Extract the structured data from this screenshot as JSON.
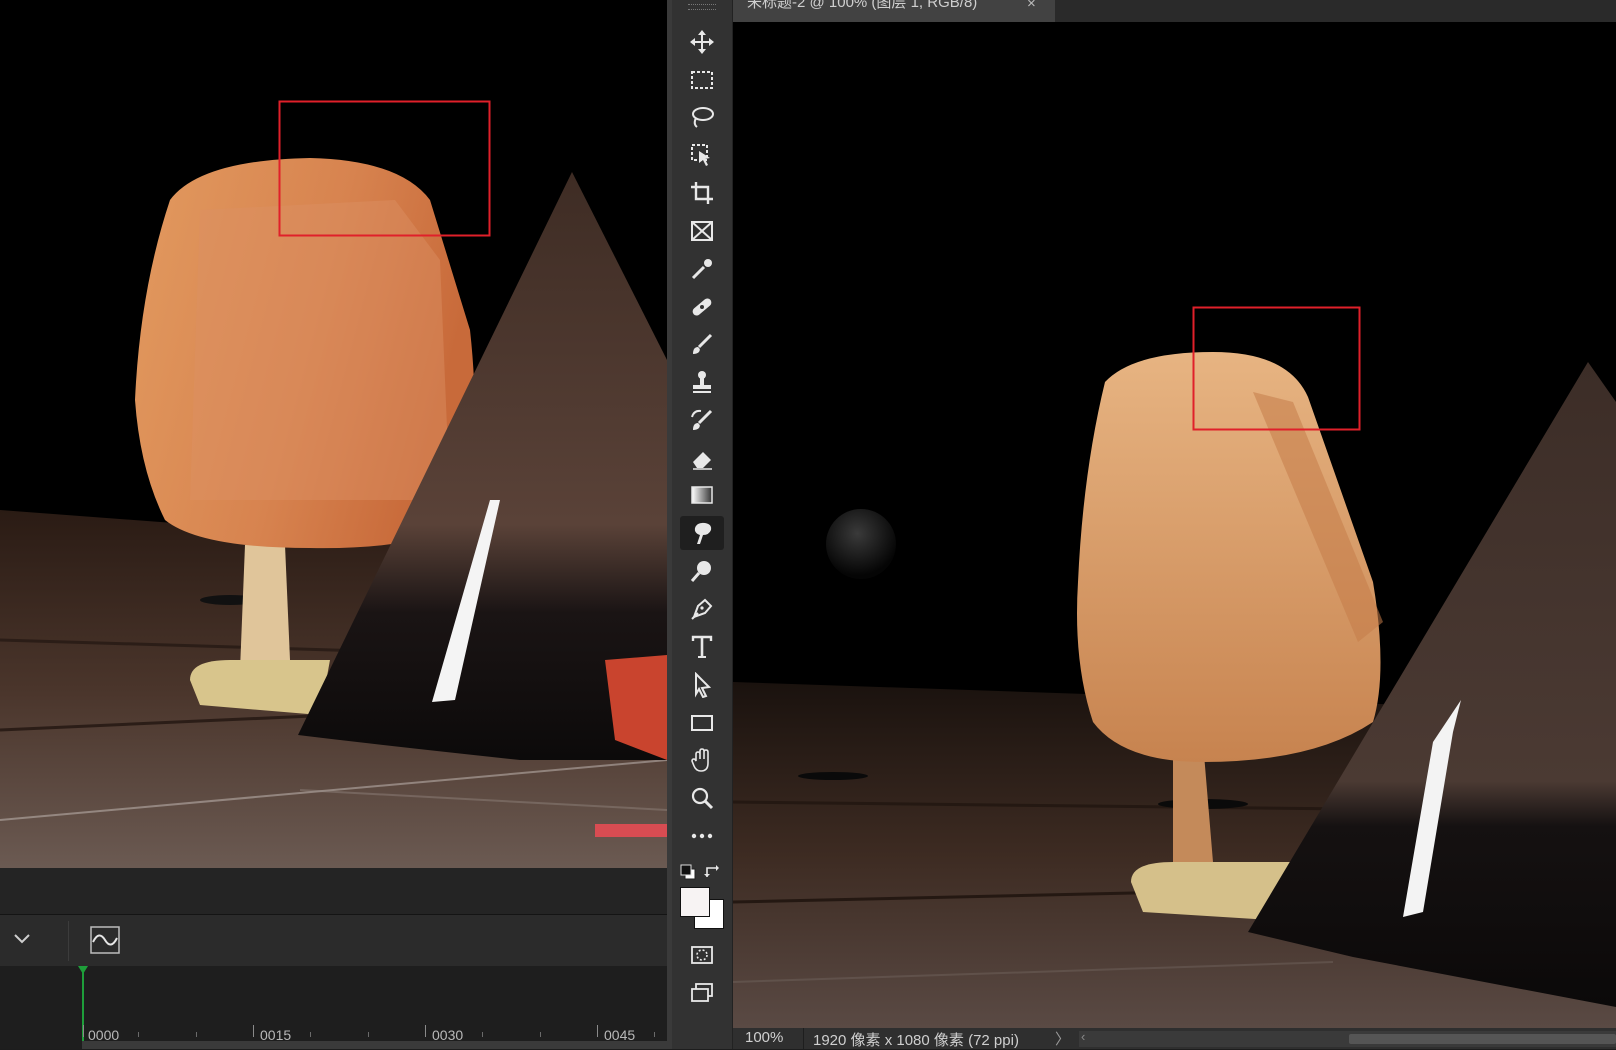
{
  "left_panel": {
    "timeline": {
      "frame_labels": [
        "0000",
        "0015",
        "0030",
        "0045"
      ]
    }
  },
  "toolbar": {
    "tools": [
      {
        "name": "move-tool",
        "icon": "move-icon"
      },
      {
        "name": "rectangular-marquee-tool",
        "icon": "marquee-icon"
      },
      {
        "name": "lasso-tool",
        "icon": "lasso-icon"
      },
      {
        "name": "object-selection-tool",
        "icon": "object-selection-icon"
      },
      {
        "name": "crop-tool",
        "icon": "crop-icon"
      },
      {
        "name": "frame-tool",
        "icon": "frame-icon"
      },
      {
        "name": "eyedropper-tool",
        "icon": "eyedropper-icon"
      },
      {
        "name": "spot-healing-brush-tool",
        "icon": "bandage-icon"
      },
      {
        "name": "brush-tool",
        "icon": "brush-icon"
      },
      {
        "name": "clone-stamp-tool",
        "icon": "stamp-icon"
      },
      {
        "name": "history-brush-tool",
        "icon": "history-brush-icon"
      },
      {
        "name": "eraser-tool",
        "icon": "eraser-icon"
      },
      {
        "name": "gradient-tool",
        "icon": "gradient-icon"
      },
      {
        "name": "smudge-tool",
        "icon": "smudge-icon",
        "active": true
      },
      {
        "name": "dodge-tool",
        "icon": "dodge-icon"
      },
      {
        "name": "pen-tool",
        "icon": "pen-icon"
      },
      {
        "name": "type-tool",
        "icon": "type-icon"
      },
      {
        "name": "path-selection-tool",
        "icon": "arrow-icon"
      },
      {
        "name": "rectangle-tool",
        "icon": "rectangle-icon"
      },
      {
        "name": "hand-tool",
        "icon": "hand-icon"
      },
      {
        "name": "zoom-tool",
        "icon": "zoom-icon"
      },
      {
        "name": "edit-toolbar",
        "icon": "ellipsis-icon"
      }
    ],
    "foreground_color": "#f7f3f3",
    "background_color": "#ffffff"
  },
  "document": {
    "tab_title": "未标题-2 @ 100% (图层 1, RGB/8)",
    "close_glyph": "×",
    "zoom": "100%",
    "info": "1920 像素 x 1080 像素 (72 ppi)",
    "status_arrow": "〉",
    "scroll_left": "‹"
  },
  "colors": {
    "annotation_red": "#e0202a",
    "chair_orange": "#d98a55",
    "floor_brown": "#3b2a22"
  }
}
